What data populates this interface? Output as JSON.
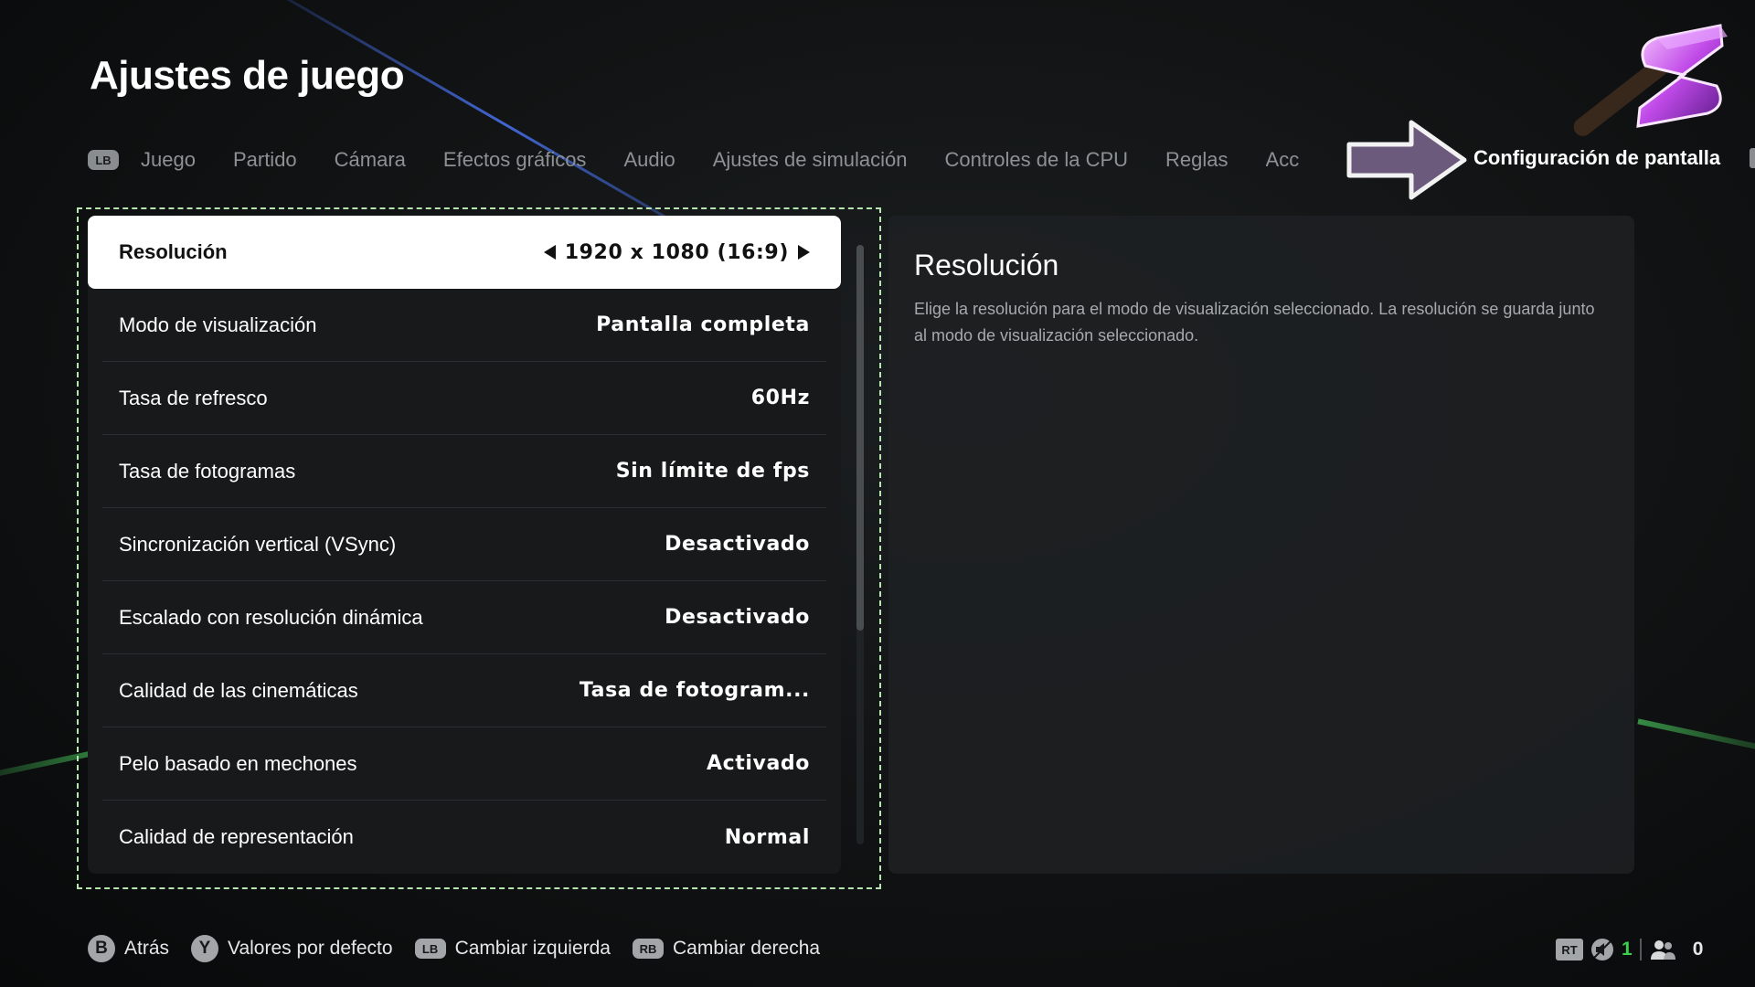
{
  "page_title": "Ajustes de juego",
  "tabs": {
    "lb_button": "LB",
    "items": [
      {
        "label": "Juego"
      },
      {
        "label": "Partido"
      },
      {
        "label": "Cámara"
      },
      {
        "label": "Efectos gráficos"
      },
      {
        "label": "Audio"
      },
      {
        "label": "Ajustes de simulación"
      },
      {
        "label": "Controles de la CPU"
      },
      {
        "label": "Reglas"
      },
      {
        "label": "Acc"
      }
    ],
    "active": "Configuración de pantalla"
  },
  "settings": [
    {
      "label": "Resolución",
      "value": "1920 x 1080 (16:9)"
    },
    {
      "label": "Modo de visualización",
      "value": "Pantalla completa"
    },
    {
      "label": "Tasa de refresco",
      "value": "60Hz"
    },
    {
      "label": "Tasa de fotogramas",
      "value": "Sin límite de fps"
    },
    {
      "label": "Sincronización vertical (VSync)",
      "value": "Desactivado"
    },
    {
      "label": "Escalado con resolución dinámica",
      "value": "Desactivado"
    },
    {
      "label": "Calidad de las cinemáticas",
      "value": "Tasa de fotogram..."
    },
    {
      "label": "Pelo basado en mechones",
      "value": "Activado"
    },
    {
      "label": "Calidad de representación",
      "value": "Normal"
    }
  ],
  "description": {
    "title": "Resolución",
    "text": "Elige la resolución para el modo de visualización seleccionado. La resolución se guarda junto al modo de visualización seleccionado."
  },
  "footer": {
    "back": {
      "button": "B",
      "label": "Atrás"
    },
    "defaults": {
      "button": "Y",
      "label": "Valores por defecto"
    },
    "switch_left": {
      "button": "LB",
      "label": "Cambiar izquierda"
    },
    "switch_right": {
      "button": "RB",
      "label": "Cambiar derecha"
    }
  },
  "status": {
    "rt_button": "RT",
    "muted_count": "1",
    "players_count": "0",
    "colors": {
      "count_green": "#3ccf4e"
    }
  },
  "icons": [
    "game-logo-icon",
    "arrow-right-icon",
    "mute-icon",
    "players-icon",
    "chevron-left-icon",
    "chevron-right-icon"
  ]
}
